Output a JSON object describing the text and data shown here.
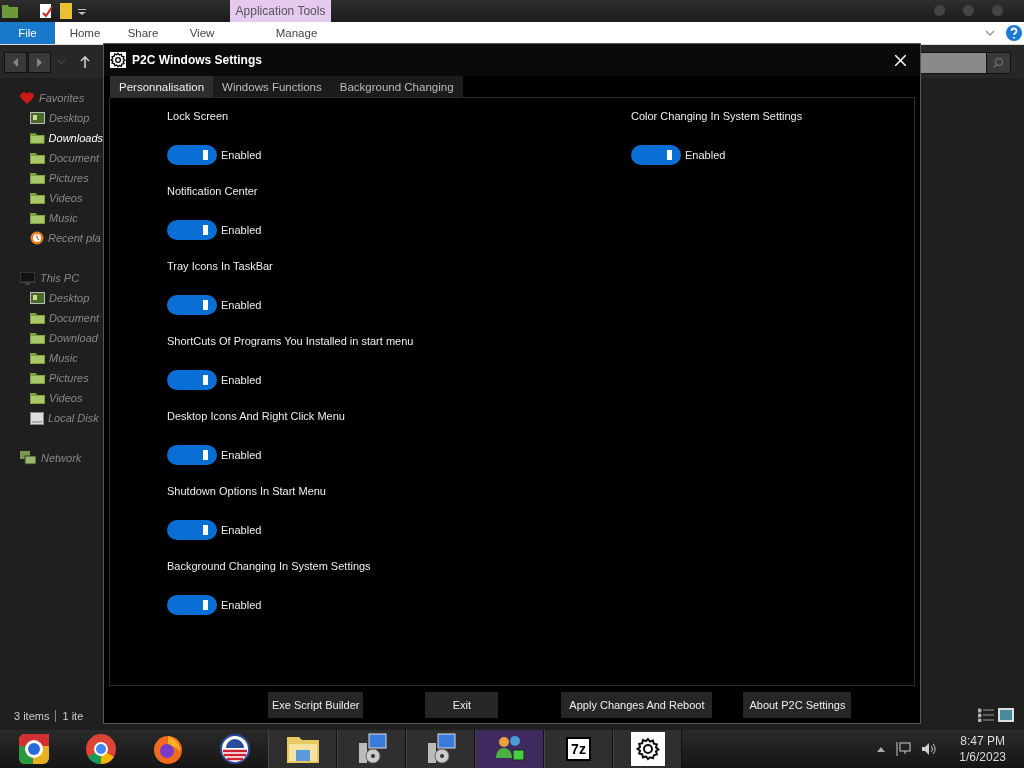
{
  "explorer": {
    "contextual_tab": "Application Tools",
    "ribbon_tabs": [
      {
        "label": "File",
        "selected": true
      },
      {
        "label": "Home",
        "selected": false
      },
      {
        "label": "Share",
        "selected": false
      },
      {
        "label": "View",
        "selected": false
      },
      {
        "label": "Manage",
        "selected": false
      }
    ],
    "sidebar": [
      {
        "label": "Favorites",
        "kind": "favorites",
        "children": [
          {
            "label": "Desktop",
            "kind": "desktop",
            "selected": false
          },
          {
            "label": "Downloads",
            "kind": "folder",
            "selected": true
          },
          {
            "label": "Document",
            "kind": "folder",
            "selected": false
          },
          {
            "label": "Pictures",
            "kind": "folder",
            "selected": false
          },
          {
            "label": "Videos",
            "kind": "folder",
            "selected": false
          },
          {
            "label": "Music",
            "kind": "folder",
            "selected": false
          },
          {
            "label": "Recent pla",
            "kind": "recent",
            "selected": false
          }
        ]
      },
      {
        "label": "This PC",
        "kind": "computer",
        "children": [
          {
            "label": "Desktop",
            "kind": "desktop",
            "selected": false
          },
          {
            "label": "Document",
            "kind": "folder",
            "selected": false
          },
          {
            "label": "Download",
            "kind": "folder",
            "selected": false
          },
          {
            "label": "Music",
            "kind": "folder",
            "selected": false
          },
          {
            "label": "Pictures",
            "kind": "folder",
            "selected": false
          },
          {
            "label": "Videos",
            "kind": "folder",
            "selected": false
          },
          {
            "label": "Local Disk",
            "kind": "disk",
            "selected": false
          }
        ]
      },
      {
        "label": "Network",
        "kind": "network"
      }
    ],
    "status_bar": [
      "3 items",
      "1 ite"
    ]
  },
  "dialog": {
    "title": "P2C Windows Settings",
    "tabs": [
      {
        "label": "Personnalisation",
        "selected": true
      },
      {
        "label": "Windows Functions",
        "selected": false
      },
      {
        "label": "Background Changing",
        "selected": false
      }
    ],
    "columns": [
      [
        {
          "label": "Lock Screen",
          "on": true,
          "state_text": "Enabled"
        },
        {
          "label": "Notification Center",
          "on": true,
          "state_text": "Enabled"
        },
        {
          "label": "Tray Icons In TaskBar",
          "on": true,
          "state_text": "Enabled"
        },
        {
          "label": "ShortCuts Of Programs You Installed in start menu",
          "on": true,
          "state_text": "Enabled"
        },
        {
          "label": "Desktop Icons And Right Click Menu",
          "on": true,
          "state_text": "Enabled"
        },
        {
          "label": "Shutdown Options In Start Menu",
          "on": true,
          "state_text": "Enabled"
        },
        {
          "label": "Background Changing In System Settings",
          "on": true,
          "state_text": "Enabled"
        }
      ],
      [
        {
          "label": "Color Changing In System Settings",
          "on": true,
          "state_text": "Enabled"
        }
      ]
    ],
    "buttons": [
      "Exe Script Builder",
      "Exit",
      "Apply Changes And Reboot",
      "About P2C Settings"
    ]
  },
  "taskbar": {
    "apps": [
      {
        "kind": "ring",
        "running": false,
        "selected": false
      },
      {
        "kind": "globe",
        "running": false,
        "selected": false
      },
      {
        "kind": "flame",
        "running": false,
        "selected": false
      },
      {
        "kind": "emblem",
        "running": false,
        "selected": false
      },
      {
        "kind": "folder",
        "running": true,
        "selected": false
      },
      {
        "kind": "installer",
        "running": true,
        "selected": false
      },
      {
        "kind": "installer",
        "running": true,
        "selected": false
      },
      {
        "kind": "people",
        "running": true,
        "selected": true
      },
      {
        "kind": "archive",
        "label": "7z",
        "running": true,
        "selected": false
      },
      {
        "kind": "gear",
        "running": true,
        "selected": false
      }
    ],
    "time": "8:47 PM",
    "date": "1/6/2023"
  }
}
